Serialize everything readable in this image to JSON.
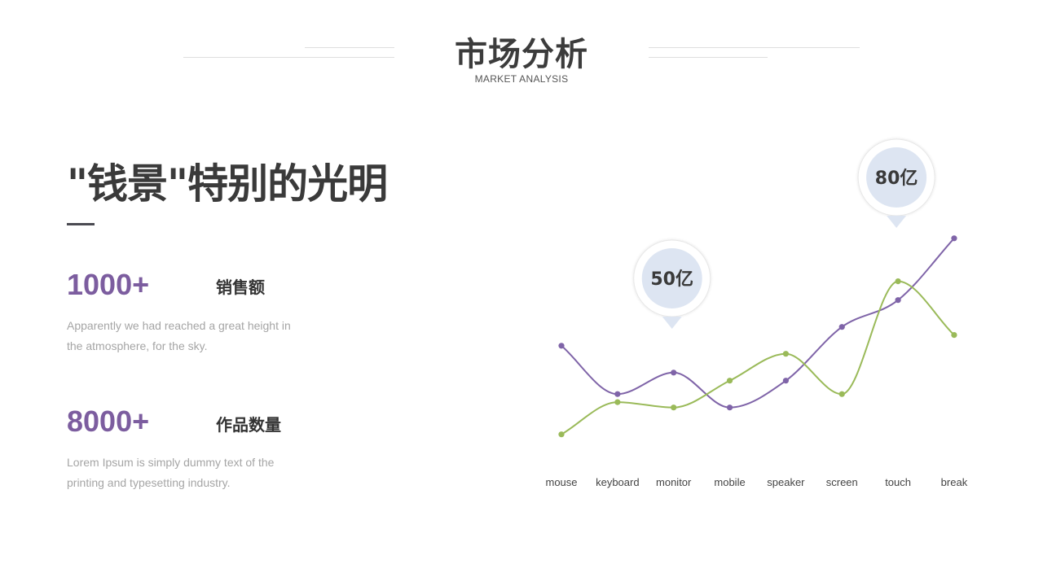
{
  "header": {
    "title": "市场分析",
    "subtitle": "MARKET ANALYSIS"
  },
  "headline": "\"钱景\"特别的光明",
  "stats": [
    {
      "value": "1000+",
      "label": "销售额",
      "description": "Apparently we had reached a great height in the atmosphere, for the sky."
    },
    {
      "value": "8000+",
      "label": "作品数量",
      "description": "Lorem Ipsum is simply dummy text of the printing and typesetting industry."
    }
  ],
  "colors": {
    "accent_purple": "#7c5d9f",
    "series_purple": "#7f64a8",
    "series_green": "#9aba59",
    "bubble_fill": "#dde5f2",
    "text_dark": "#3a3a3a",
    "text_muted": "#a5a5a5"
  },
  "chart_data": {
    "type": "line",
    "smooth": true,
    "title": "",
    "xlabel": "",
    "ylabel": "",
    "y_axis_visible": false,
    "grid": false,
    "legend": "none",
    "ylim": [
      0,
      100
    ],
    "categories": [
      "mouse",
      "keyboard",
      "monitor",
      "mobile",
      "speaker",
      "screen",
      "touch",
      "break"
    ],
    "series": [
      {
        "color": "#7f64a8",
        "values": [
          44,
          26,
          34,
          21,
          31,
          51,
          61,
          84
        ]
      },
      {
        "color": "#9aba59",
        "values": [
          11,
          23,
          21,
          31,
          41,
          26,
          68,
          48
        ]
      }
    ],
    "annotations": [
      {
        "text": "50亿",
        "category": "monitor"
      },
      {
        "text": "80亿",
        "category": "touch"
      }
    ]
  }
}
